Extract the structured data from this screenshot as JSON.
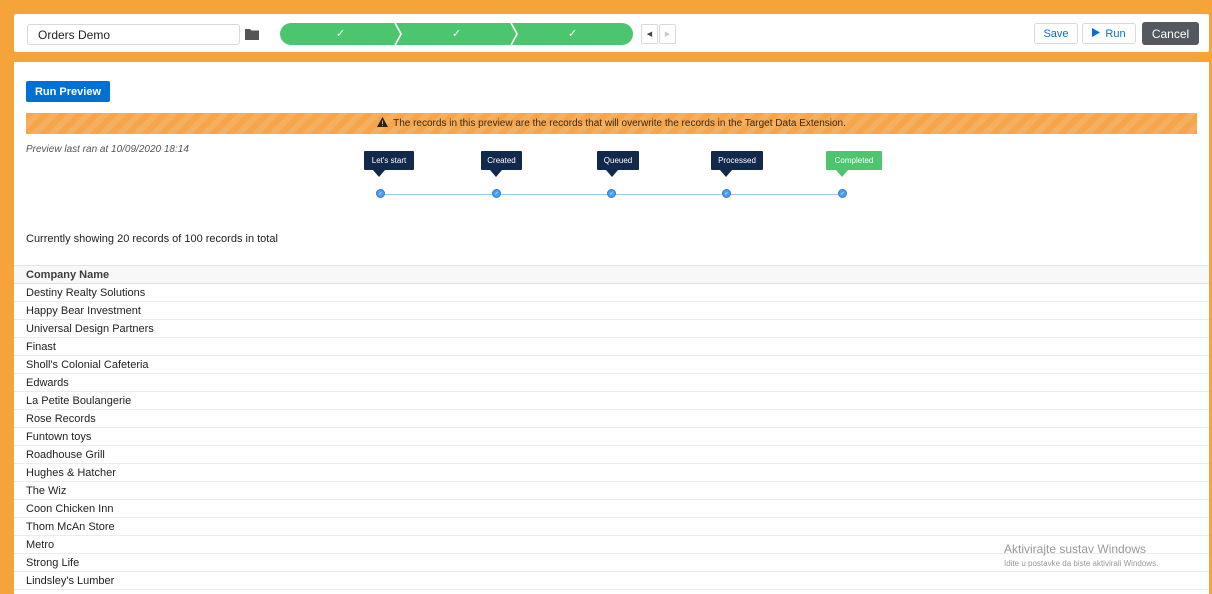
{
  "toolbar": {
    "name_value": "Orders Demo",
    "save_label": "Save",
    "run_label": "Run",
    "cancel_label": "Cancel",
    "steps": [
      "✓",
      "✓",
      "✓"
    ],
    "step_color": "#4dc56f"
  },
  "preview": {
    "run_preview_label": "Run Preview",
    "warning_text": "The records in this preview are the records that will overwrite the records in the Target Data Extension.",
    "last_ran": "Preview last ran at 10/09/2020 18:14",
    "timeline": [
      {
        "label": "Let's start",
        "status": "done"
      },
      {
        "label": "Created",
        "status": "done"
      },
      {
        "label": "Queued",
        "status": "done"
      },
      {
        "label": "Processed",
        "status": "done"
      },
      {
        "label": "Completed",
        "status": "current"
      }
    ],
    "count_text": "Currently showing 20 records of 100 records in total"
  },
  "table": {
    "header": "Company Name",
    "rows": [
      "Destiny Realty Solutions",
      "Happy Bear Investment",
      "Universal Design Partners",
      "Finast",
      "Sholl's Colonial Cafeteria",
      "Edwards",
      "La Petite Boulangerie",
      "Rose Records",
      "Funtown toys",
      "Roadhouse Grill",
      "Hughes & Hatcher",
      "The Wiz",
      "Coon Chicken Inn",
      "Thom McAn Store",
      "Metro",
      "Strong Life",
      "Lindsley's Lumber"
    ]
  },
  "watermark": {
    "line1": "Aktivirajte sustav Windows",
    "line2": "Idite u postavke da biste aktivirali Windows."
  },
  "colors": {
    "accent_orange": "#f6a33a",
    "brand_blue": "#0070d2",
    "navy": "#12284c",
    "success_green": "#4dc56f"
  },
  "icons": {
    "folder": "folder-icon",
    "prev": "triangle-left-icon",
    "next": "triangle-right-icon",
    "play": "play-icon",
    "warning": "warning-icon",
    "check": "check-icon"
  }
}
